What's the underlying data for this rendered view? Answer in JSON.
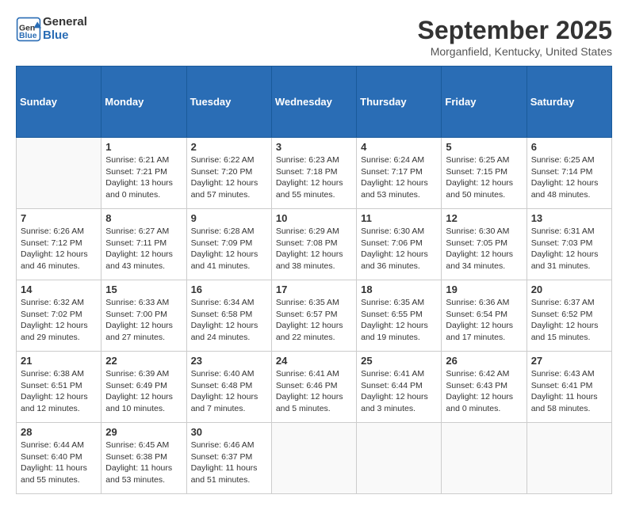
{
  "header": {
    "logo_line1": "General",
    "logo_line2": "Blue",
    "month": "September 2025",
    "location": "Morganfield, Kentucky, United States"
  },
  "weekdays": [
    "Sunday",
    "Monday",
    "Tuesday",
    "Wednesday",
    "Thursday",
    "Friday",
    "Saturday"
  ],
  "weeks": [
    [
      {
        "day": "",
        "info": ""
      },
      {
        "day": "1",
        "info": "Sunrise: 6:21 AM\nSunset: 7:21 PM\nDaylight: 13 hours\nand 0 minutes."
      },
      {
        "day": "2",
        "info": "Sunrise: 6:22 AM\nSunset: 7:20 PM\nDaylight: 12 hours\nand 57 minutes."
      },
      {
        "day": "3",
        "info": "Sunrise: 6:23 AM\nSunset: 7:18 PM\nDaylight: 12 hours\nand 55 minutes."
      },
      {
        "day": "4",
        "info": "Sunrise: 6:24 AM\nSunset: 7:17 PM\nDaylight: 12 hours\nand 53 minutes."
      },
      {
        "day": "5",
        "info": "Sunrise: 6:25 AM\nSunset: 7:15 PM\nDaylight: 12 hours\nand 50 minutes."
      },
      {
        "day": "6",
        "info": "Sunrise: 6:25 AM\nSunset: 7:14 PM\nDaylight: 12 hours\nand 48 minutes."
      }
    ],
    [
      {
        "day": "7",
        "info": "Sunrise: 6:26 AM\nSunset: 7:12 PM\nDaylight: 12 hours\nand 46 minutes."
      },
      {
        "day": "8",
        "info": "Sunrise: 6:27 AM\nSunset: 7:11 PM\nDaylight: 12 hours\nand 43 minutes."
      },
      {
        "day": "9",
        "info": "Sunrise: 6:28 AM\nSunset: 7:09 PM\nDaylight: 12 hours\nand 41 minutes."
      },
      {
        "day": "10",
        "info": "Sunrise: 6:29 AM\nSunset: 7:08 PM\nDaylight: 12 hours\nand 38 minutes."
      },
      {
        "day": "11",
        "info": "Sunrise: 6:30 AM\nSunset: 7:06 PM\nDaylight: 12 hours\nand 36 minutes."
      },
      {
        "day": "12",
        "info": "Sunrise: 6:30 AM\nSunset: 7:05 PM\nDaylight: 12 hours\nand 34 minutes."
      },
      {
        "day": "13",
        "info": "Sunrise: 6:31 AM\nSunset: 7:03 PM\nDaylight: 12 hours\nand 31 minutes."
      }
    ],
    [
      {
        "day": "14",
        "info": "Sunrise: 6:32 AM\nSunset: 7:02 PM\nDaylight: 12 hours\nand 29 minutes."
      },
      {
        "day": "15",
        "info": "Sunrise: 6:33 AM\nSunset: 7:00 PM\nDaylight: 12 hours\nand 27 minutes."
      },
      {
        "day": "16",
        "info": "Sunrise: 6:34 AM\nSunset: 6:58 PM\nDaylight: 12 hours\nand 24 minutes."
      },
      {
        "day": "17",
        "info": "Sunrise: 6:35 AM\nSunset: 6:57 PM\nDaylight: 12 hours\nand 22 minutes."
      },
      {
        "day": "18",
        "info": "Sunrise: 6:35 AM\nSunset: 6:55 PM\nDaylight: 12 hours\nand 19 minutes."
      },
      {
        "day": "19",
        "info": "Sunrise: 6:36 AM\nSunset: 6:54 PM\nDaylight: 12 hours\nand 17 minutes."
      },
      {
        "day": "20",
        "info": "Sunrise: 6:37 AM\nSunset: 6:52 PM\nDaylight: 12 hours\nand 15 minutes."
      }
    ],
    [
      {
        "day": "21",
        "info": "Sunrise: 6:38 AM\nSunset: 6:51 PM\nDaylight: 12 hours\nand 12 minutes."
      },
      {
        "day": "22",
        "info": "Sunrise: 6:39 AM\nSunset: 6:49 PM\nDaylight: 12 hours\nand 10 minutes."
      },
      {
        "day": "23",
        "info": "Sunrise: 6:40 AM\nSunset: 6:48 PM\nDaylight: 12 hours\nand 7 minutes."
      },
      {
        "day": "24",
        "info": "Sunrise: 6:41 AM\nSunset: 6:46 PM\nDaylight: 12 hours\nand 5 minutes."
      },
      {
        "day": "25",
        "info": "Sunrise: 6:41 AM\nSunset: 6:44 PM\nDaylight: 12 hours\nand 3 minutes."
      },
      {
        "day": "26",
        "info": "Sunrise: 6:42 AM\nSunset: 6:43 PM\nDaylight: 12 hours\nand 0 minutes."
      },
      {
        "day": "27",
        "info": "Sunrise: 6:43 AM\nSunset: 6:41 PM\nDaylight: 11 hours\nand 58 minutes."
      }
    ],
    [
      {
        "day": "28",
        "info": "Sunrise: 6:44 AM\nSunset: 6:40 PM\nDaylight: 11 hours\nand 55 minutes."
      },
      {
        "day": "29",
        "info": "Sunrise: 6:45 AM\nSunset: 6:38 PM\nDaylight: 11 hours\nand 53 minutes."
      },
      {
        "day": "30",
        "info": "Sunrise: 6:46 AM\nSunset: 6:37 PM\nDaylight: 11 hours\nand 51 minutes."
      },
      {
        "day": "",
        "info": ""
      },
      {
        "day": "",
        "info": ""
      },
      {
        "day": "",
        "info": ""
      },
      {
        "day": "",
        "info": ""
      }
    ]
  ]
}
